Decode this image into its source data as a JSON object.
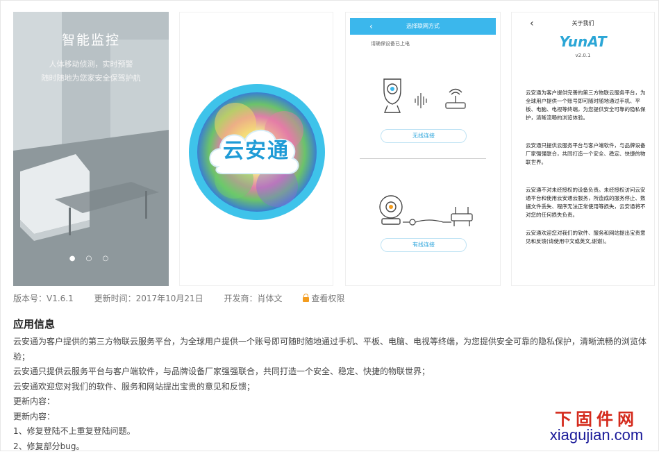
{
  "screenshots": {
    "shot1": {
      "title": "智能监控",
      "subtitle_line1": "人体移动侦测，实时预警",
      "subtitle_line2": "随时随地为您家安全保驾护航",
      "dots": "● ○ ○"
    },
    "shot2": {
      "logo_text": "云安通"
    },
    "shot3": {
      "header_title": "选择联网方式",
      "back_icon": "chevron-left-icon",
      "hint": "请确保设备已上电",
      "wireless_button": "无线连接",
      "wired_button": "有线连接"
    },
    "shot4": {
      "back_icon": "chevron-left-icon",
      "title": "关于我们",
      "brand": "YunAT",
      "version": "v2.0.1",
      "para1": "云安通为客户提供完善的第三方物联云服务平台，为全球用户提供一个账号即可随时随地通过手机、平板、电脑、电视等终端，为您提供安全可靠的隐私保护，清晰流畅的浏览体验。",
      "para2": "云安通只提供云服务平台与客户端软件，与品牌设备厂家强强联合，共同打造一个安全、稳定、快捷的物联世界。",
      "para3": "云安通不对未经授权的设备负责。未经授权访问云安通平台和使用云安通云服务，所造成的服务停止、数据文件丢失、程序无法正常使用等损失，云安通将不对您的任何损失负责。",
      "para4": "云安通欢迎您对我们的软件、服务和网站提出宝贵意见和反馈(请使用中文或英文,谢谢)。"
    }
  },
  "meta": {
    "version": "版本号：V1.6.1",
    "updated": "更新时间：2017年10月21日",
    "developer": "开发商：肖体文",
    "permissions": "查看权限",
    "lock_icon": "lock-icon"
  },
  "app_info": {
    "title": "应用信息",
    "line1": "云安通为客户提供的第三方物联云服务平台，为全球用户提供一个账号即可随时随地通过手机、平板、电脑、电视等终端，为您提供安全可靠的隐私保护，清晰流畅的浏览体验；",
    "line2": "云安通只提供云服务平台与客户端软件，与品牌设备厂家强强联合，共同打造一个安全、稳定、快捷的物联世界；",
    "line3": "云安通欢迎您对我们的软件、服务和网站提出宝贵的意见和反馈；",
    "line4": "更新内容：",
    "line5": "更新内容：",
    "line6": "1、修复登陆不上重复登陆问题。",
    "line7": "2、修复部分bug。"
  },
  "watermark": {
    "cn": "下固件网",
    "en": "xiagujian.com"
  },
  "colors": {
    "accent_blue": "#3bb7ec",
    "lock_orange": "#f39c1f",
    "watermark_red": "#d42a1c",
    "watermark_blue": "#1a1a99"
  }
}
